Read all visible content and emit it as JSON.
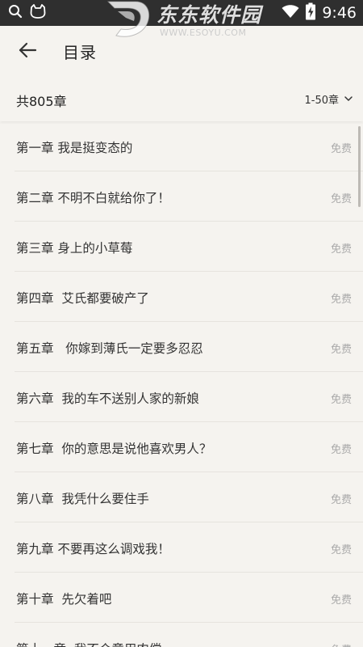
{
  "status_bar": {
    "time": "9:46",
    "left_icons": [
      "search-icon",
      "cat-face-icon"
    ],
    "right_icons": [
      "wifi-icon",
      "battery-charging-icon"
    ]
  },
  "watermark": {
    "title": "东东软件园",
    "url": "WWW.ESOYU.COM"
  },
  "header": {
    "title": "目录",
    "back_icon": "arrow-left-icon"
  },
  "summary": {
    "chapter_count": "共805章",
    "range_label": "1-50章",
    "dropdown_icon": "chevron-down-icon"
  },
  "chapters": [
    {
      "title": "第一章 我是挺变态的",
      "tag": "免费"
    },
    {
      "title": "第二章 不明不白就给你了！",
      "tag": "免费"
    },
    {
      "title": "第三章 身上的小草莓",
      "tag": "免费"
    },
    {
      "title": "第四章  艾氏都要破产了",
      "tag": "免费"
    },
    {
      "title": "第五章   你嫁到薄氏一定要多忍忍",
      "tag": "免费"
    },
    {
      "title": "第六章  我的车不送别人家的新娘",
      "tag": "免费"
    },
    {
      "title": "第七章  你的意思是说他喜欢男人？",
      "tag": "免费"
    },
    {
      "title": "第八章  我凭什么要住手",
      "tag": "免费"
    },
    {
      "title": "第九章 不要再这么调戏我！",
      "tag": "免费"
    },
    {
      "title": "第十章  先欠着吧",
      "tag": "免费"
    },
    {
      "title": "第十一章  我不介意用肉偿",
      "tag": "免费"
    }
  ],
  "colors": {
    "status_bar_bg": "#2f2f2f",
    "page_bg": "#f5f3ef",
    "tag_text": "#aaaaaa",
    "divider": "#e6e3de"
  }
}
